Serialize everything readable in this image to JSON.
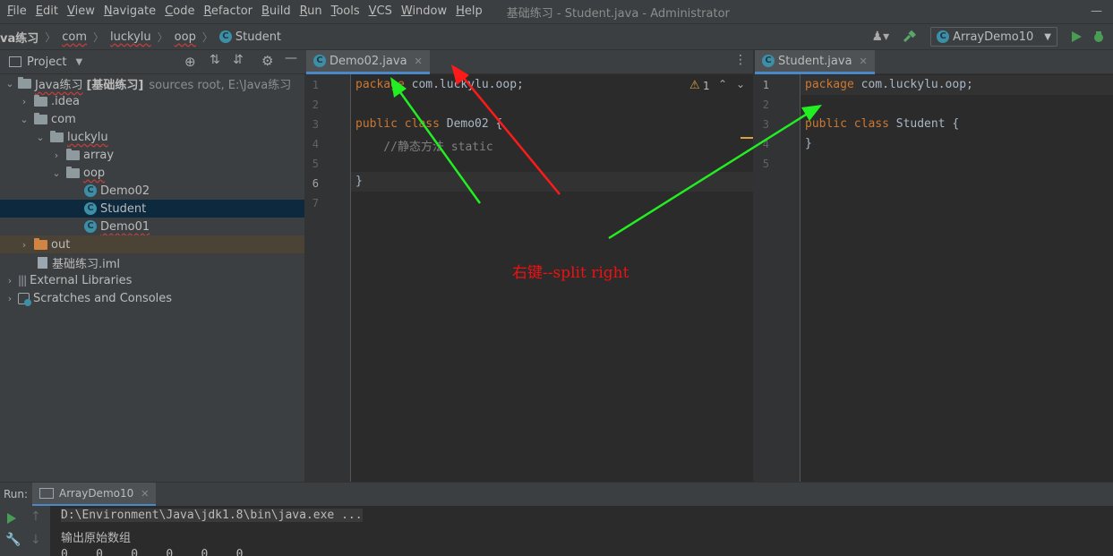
{
  "menu": {
    "items": [
      {
        "key": "F",
        "rest": "ile"
      },
      {
        "key": "E",
        "rest": "dit"
      },
      {
        "key": "V",
        "rest": "iew"
      },
      {
        "key": "N",
        "rest": "avigate"
      },
      {
        "key": "C",
        "rest": "ode"
      },
      {
        "key": "R",
        "rest": "efactor"
      },
      {
        "key": "B",
        "rest": "uild"
      },
      {
        "key": "R",
        "rest": "un"
      },
      {
        "key": "T",
        "rest": "ools"
      },
      {
        "key": "V",
        "rest": "CS"
      },
      {
        "key": "W",
        "rest": "indow"
      },
      {
        "key": "H",
        "rest": "elp"
      }
    ],
    "window_title": "基础练习 - Student.java - Administrator"
  },
  "breadcrumb": [
    "va练习",
    "com",
    "luckylu",
    "oop",
    "Student"
  ],
  "run_config": "ArrayDemo10",
  "project_panel": {
    "title": "Project",
    "tree": [
      {
        "label": "Java练习",
        "extra": "[基础练习]",
        "hint": "sources root,  E:\\Java练习",
        "arrow": "down",
        "depth": 0,
        "icon": "folder"
      },
      {
        "label": ".idea",
        "arrow": "right",
        "depth": 1,
        "icon": "folder"
      },
      {
        "label": "com",
        "arrow": "down",
        "depth": 1,
        "icon": "folder"
      },
      {
        "label": "luckylu",
        "arrow": "down",
        "depth": 2,
        "icon": "folder"
      },
      {
        "label": "array",
        "arrow": "right",
        "depth": 3,
        "icon": "folder"
      },
      {
        "label": "oop",
        "arrow": "down",
        "depth": 3,
        "icon": "folder"
      },
      {
        "label": "Demo02",
        "arrow": "",
        "depth": 4,
        "icon": "class"
      },
      {
        "label": "Student",
        "arrow": "",
        "depth": 4,
        "icon": "class",
        "selected": true
      },
      {
        "label": "Demo01",
        "arrow": "",
        "depth": 4,
        "icon": "class"
      },
      {
        "label": "out",
        "arrow": "right",
        "depth": 1,
        "icon": "folder-orange",
        "highlight": true
      },
      {
        "label": "基础练习.iml",
        "arrow": "",
        "depth": 1,
        "icon": "file"
      },
      {
        "label": "External Libraries",
        "arrow": "right",
        "depth": 0,
        "icon": "library"
      },
      {
        "label": "Scratches and Consoles",
        "arrow": "right",
        "depth": 0,
        "icon": "scratch"
      }
    ]
  },
  "editor_left": {
    "tab": "Demo02.java",
    "warning_count": "1",
    "line_numbers": [
      "1",
      "2",
      "3",
      "4",
      "5",
      "6",
      "7"
    ],
    "code": {
      "l1_kw": "package",
      "l1_rest": " com.luckylu.oop;",
      "l3_kw": "public class",
      "l3_cls": " Demo02 {",
      "l4_cm": "    //静态方法 static",
      "l6": "}"
    }
  },
  "editor_right": {
    "tab": "Student.java",
    "line_numbers": [
      "1",
      "2",
      "3",
      "4",
      "5"
    ],
    "code": {
      "l1_kw": "package",
      "l1_rest": " com.luckylu.oop;",
      "l3_kw": "public class",
      "l3_cls": " Student {",
      "l4": "}"
    }
  },
  "annotation": "右键--split right",
  "run_panel": {
    "label": "Run:",
    "tab": "ArrayDemo10",
    "console": [
      "D:\\Environment\\Java\\jdk1.8\\bin\\java.exe ...",
      "输出原始数组",
      "0    0    0    0    0    0"
    ]
  },
  "colors": {
    "arrow_red": "#ff1a1a",
    "arrow_green": "#22ee22",
    "accent": "#4a88c7"
  }
}
